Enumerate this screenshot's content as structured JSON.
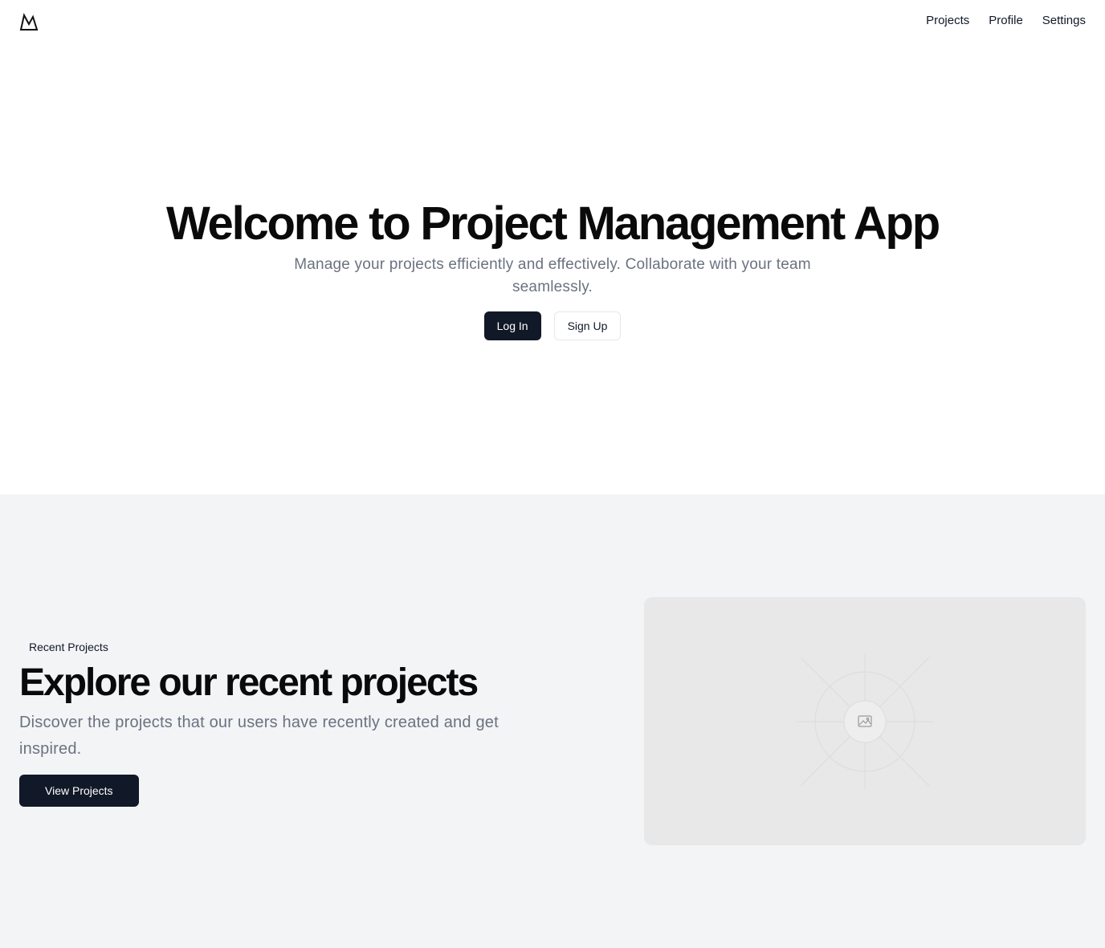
{
  "header": {
    "logo": "mountain-logo-icon",
    "nav": [
      {
        "label": "Projects"
      },
      {
        "label": "Profile"
      },
      {
        "label": "Settings"
      }
    ]
  },
  "hero": {
    "title": "Welcome to Project Management App",
    "subtitle": "Manage your projects efficiently and effectively. Collaborate with your team seamlessly.",
    "login_label": "Log In",
    "signup_label": "Sign Up"
  },
  "recent": {
    "badge": "Recent Projects",
    "title": "Explore our recent projects",
    "description": "Discover the projects that our users have recently created and get inspired.",
    "button_label": "View Projects",
    "image_icon": "image-placeholder-icon"
  },
  "colors": {
    "primary_button": "#111827",
    "section_bg": "#f2f4f6",
    "muted_text": "#6b7280",
    "placeholder_bg": "#e8e8e8"
  }
}
